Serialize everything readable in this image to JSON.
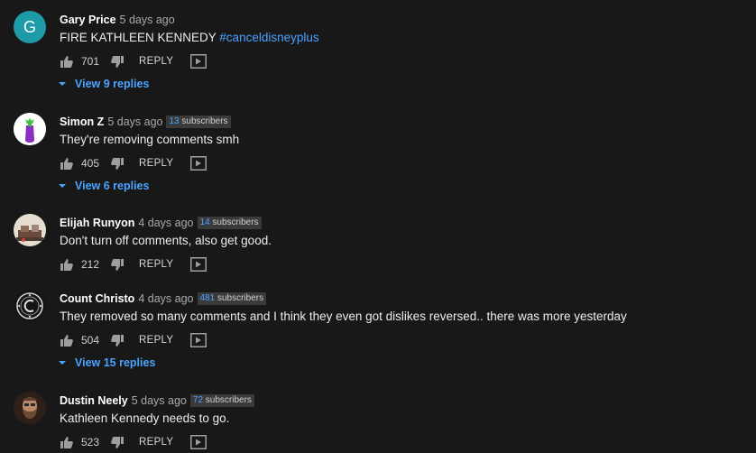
{
  "comments": [
    {
      "author": "Gary Price",
      "time": "5 days ago",
      "subscribers": null,
      "text_main": "FIRE KATHLEEN KENNEDY ",
      "text_hashtag": "#canceldisneyplus",
      "likes": "701",
      "reply_label": "REPLY",
      "view_replies": "View 9 replies",
      "avatar_letter": "G"
    },
    {
      "author": "Simon Z",
      "time": "5 days ago",
      "subscribers_num": "13",
      "subscribers_word": "subscribers",
      "text_main": "They're removing comments smh",
      "likes": "405",
      "reply_label": "REPLY",
      "view_replies": "View 6 replies"
    },
    {
      "author": "Elijah Runyon",
      "time": "4 days ago",
      "subscribers_num": "14",
      "subscribers_word": "subscribers",
      "text_main": "Don't turn off comments, also get good.",
      "likes": "212",
      "reply_label": "REPLY"
    },
    {
      "author": "Count Christo",
      "time": "4 days ago",
      "subscribers_num": "481",
      "subscribers_word": "subscribers",
      "text_main": "They removed so many comments and I think they even got dislikes reversed.. there was more yesterday",
      "likes": "504",
      "reply_label": "REPLY",
      "view_replies": "View 15 replies"
    },
    {
      "author": "Dustin Neely",
      "time": "5 days ago",
      "subscribers_num": "72",
      "subscribers_word": "subscribers",
      "text_main": "Kathleen Kennedy needs to go.",
      "likes": "523",
      "reply_label": "REPLY"
    }
  ],
  "colors": {
    "background": "#181818",
    "link_blue": "#4aa3ff",
    "avatar_teal": "#1e9aa8"
  },
  "icons": [
    "thumbs-up-icon",
    "thumbs-down-icon",
    "video-reply-icon",
    "chevron-down-icon"
  ]
}
